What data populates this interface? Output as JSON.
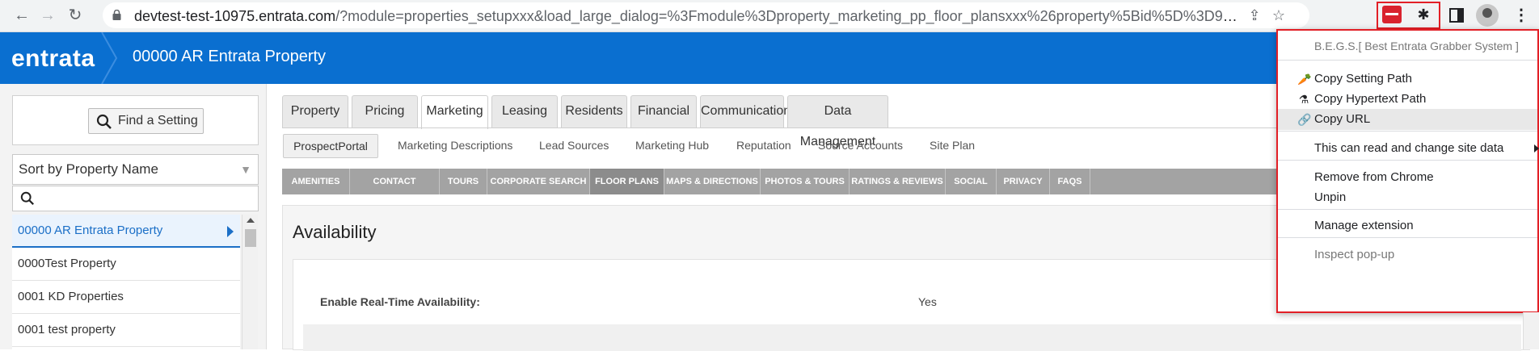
{
  "browser": {
    "url_host": "devtest-test-10975.entrata.com",
    "url_path": "/?module=properties_setupxxx&load_large_dialog=%3Fmodule%3Dproperty_marketing_pp_floor_plansxxx%26property%5Bid%5D%3D990180%26target_..."
  },
  "app": {
    "logo": "entrata",
    "title": "00000 AR Entrata Property"
  },
  "sidebar": {
    "find_label": "Find a Setting",
    "sort_label": "Sort by Property Name",
    "search_placeholder": "",
    "properties": [
      "00000 AR Entrata Property",
      "0000Test Property",
      "0001 KD Properties",
      "0001 test property"
    ]
  },
  "tabs": [
    "Property",
    "Pricing",
    "Marketing",
    "Leasing",
    "Residents",
    "Financial",
    "Communication",
    "Data Management"
  ],
  "active_tab": "Marketing",
  "subnav": [
    "ProspectPortal",
    "Marketing Descriptions",
    "Lead Sources",
    "Marketing Hub",
    "Reputation",
    "Source Accounts",
    "Site Plan"
  ],
  "gray_nav": [
    "AMENITIES",
    "CONTACT METHODS",
    "TOURS",
    "CORPORATE SEARCH",
    "FLOOR PLANS",
    "MAPS & DIRECTIONS",
    "PHOTOS & TOURS",
    "RATINGS & REVIEWS",
    "SOCIAL",
    "PRIVACY",
    "FAQS"
  ],
  "active_gray": "FLOOR PLANS",
  "content": {
    "title": "Availability",
    "field_label": "Enable Real-Time Availability:",
    "field_value": "Yes"
  },
  "context_menu": {
    "header": "B.E.G.S.[ Best Entrata Grabber System ]",
    "copy_setting_path": "Copy Setting Path",
    "copy_hypertext_path": "Copy Hypertext Path",
    "copy_url": "Copy URL",
    "site_data": "This can read and change site data",
    "remove": "Remove from Chrome",
    "unpin": "Unpin",
    "manage": "Manage extension",
    "inspect": "Inspect pop-up"
  },
  "colors": {
    "brand_blue": "#0a6fd0",
    "highlight_red": "#e21f26"
  }
}
